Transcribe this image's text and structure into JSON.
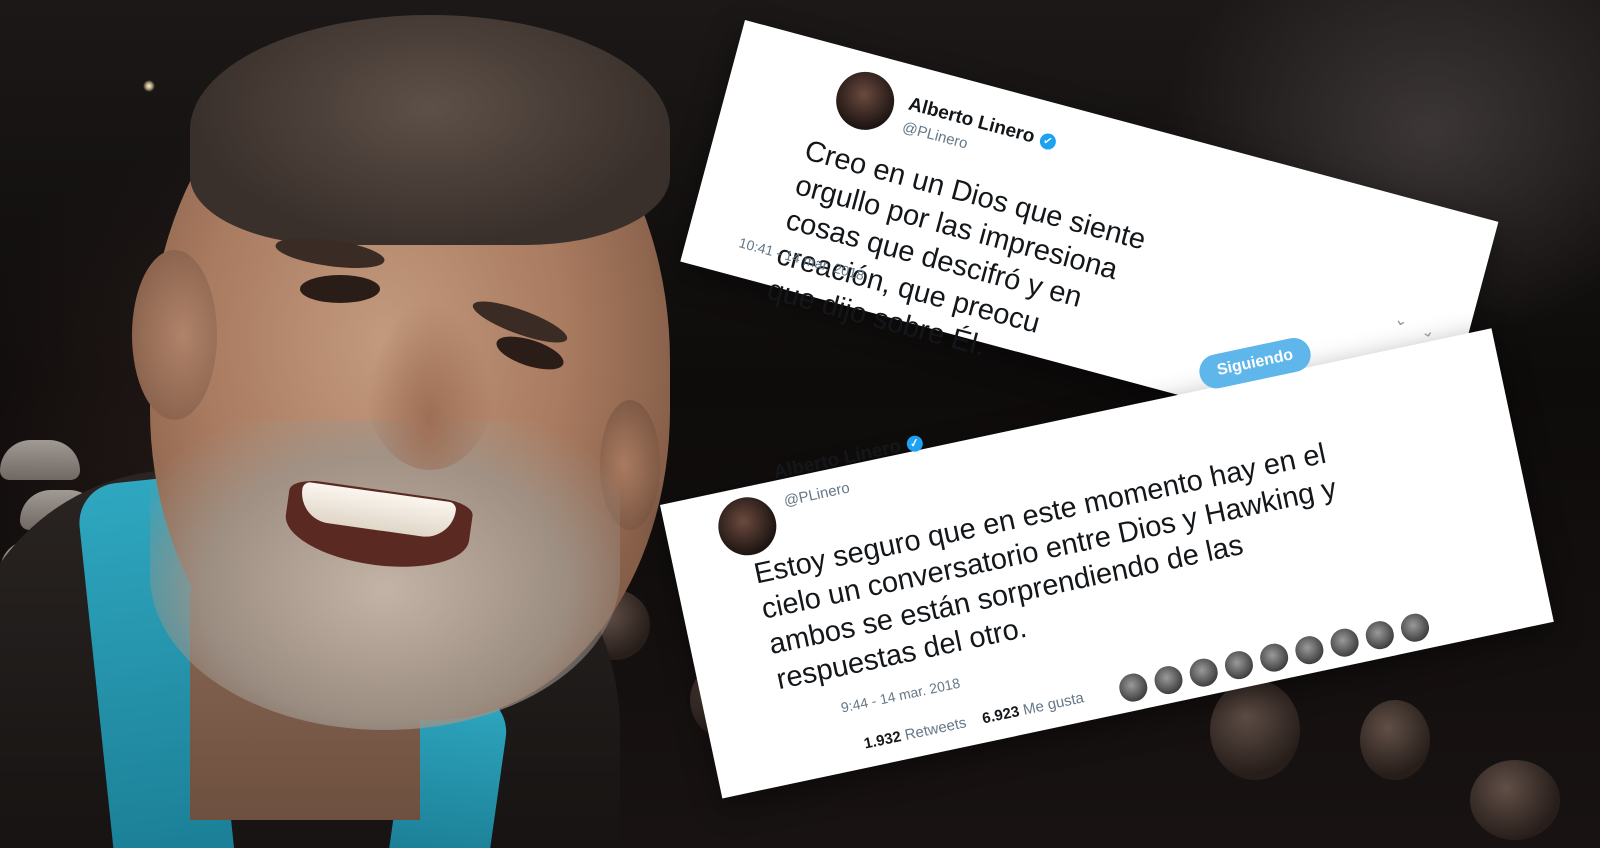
{
  "tweet_top": {
    "author_name": "Alberto Linero",
    "handle": "@PLinero",
    "lines": [
      "Creo en un Dios que siente",
      "orgullo por las impresiona",
      "cosas que descifró y en",
      "creación, que preocu",
      "que dijo sobre Él."
    ],
    "timestamp": "10:41 - 14 mar. 2018"
  },
  "tweet_bottom": {
    "follow_label": "Siguiendo",
    "author_name": "Alberto Linero",
    "handle": "@PLinero",
    "lines": [
      "Estoy seguro que en este momento hay en el",
      "cielo un conversatorio entre Dios y Hawking y",
      "ambos se están sorprendiendo de las",
      "respuestas del otro."
    ],
    "timestamp": "9:44 - 14 mar. 2018",
    "retweets_count": "1.932",
    "retweets_label": "Retweets",
    "likes_count": "6.923",
    "likes_label": "Me gusta"
  }
}
